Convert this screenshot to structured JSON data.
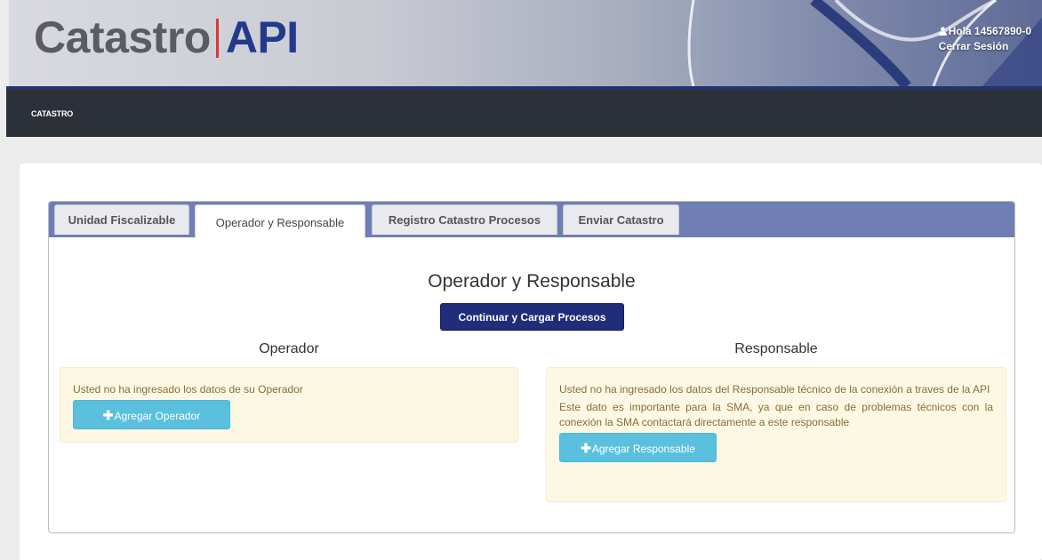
{
  "header": {
    "logo_part1": "Catastro",
    "logo_part2": "API",
    "greeting": "Hola 14567890-0",
    "logout": "Cerrar Sesión",
    "user_icon": "user-icon"
  },
  "nav": {
    "items": [
      {
        "label": "CATASTRO"
      }
    ]
  },
  "tabs": [
    {
      "label": "Unidad Fiscalizable",
      "active": false
    },
    {
      "label": "Operador y Responsable",
      "active": true
    },
    {
      "label": "Registro Catastro Procesos",
      "active": false
    },
    {
      "label": "Enviar Catastro",
      "active": false
    }
  ],
  "main": {
    "title": "Operador y Responsable",
    "continue_button": "Continuar y Cargar Procesos",
    "operador": {
      "title": "Operador",
      "message": "Usted no ha ingresado los datos de su Operador",
      "button": "Agregar Operador"
    },
    "responsable": {
      "title": "Responsable",
      "message1": "Usted no ha ingresado los datos del Responsable técnico de la conexión a traves de la API",
      "message2": "Este dato es importante para la SMA, ya que en caso de problemas técnicos con la conexión la SMA contactará directamente a este responsable",
      "button": "Agregar Responsable"
    }
  },
  "colors": {
    "brand_blue": "#233a8a",
    "brand_red": "#e2332f",
    "navbar": "#2c3139",
    "tabbar": "#6f7fb5",
    "primary_button": "#1f2d7a",
    "info_button": "#5bc0de",
    "warning_bg": "#fcf8e3",
    "warning_text": "#8a6d3b"
  }
}
